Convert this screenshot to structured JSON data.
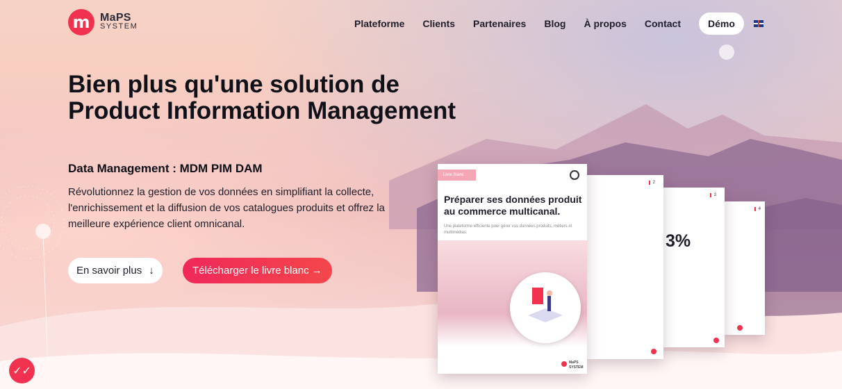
{
  "brand": {
    "logo_letter": "m",
    "name_top": "MaPS",
    "name_bottom": "SYSTEM",
    "color": "#f0324f"
  },
  "nav": {
    "items": [
      "Plateforme",
      "Clients",
      "Partenaires",
      "Blog",
      "À propos",
      "Contact"
    ],
    "demo": "Démo",
    "language_icon": "uk-flag-icon"
  },
  "hero": {
    "title_line1": "Bien plus qu'une solution de",
    "title_line2": "Product Information Management",
    "subtitle": "Data Management : MDM PIM DAM",
    "description": "Révolutionnez la gestion de vos données en simplifiant la collecte, l'enrichissement et la diffusion de vos catalogues produits et offrez la meilleure expérience client omnicanal.",
    "btn_more": "En savoir plus",
    "btn_more_icon": "↓",
    "btn_download": "Télécharger le livre blanc →"
  },
  "ebook": {
    "tag": "Livre Blanc",
    "title": "Préparer ses données produit au commerce multicanal.",
    "text": "Une plateforme efficiente pour gérer vos données produits, métiers et multimédias.",
    "page2_num": "2",
    "page3_num": "3",
    "page4_num": "4",
    "stat": "3%",
    "brand_small": "MaPS SYSTEM"
  },
  "fab_icon": "checkmarks-icon"
}
